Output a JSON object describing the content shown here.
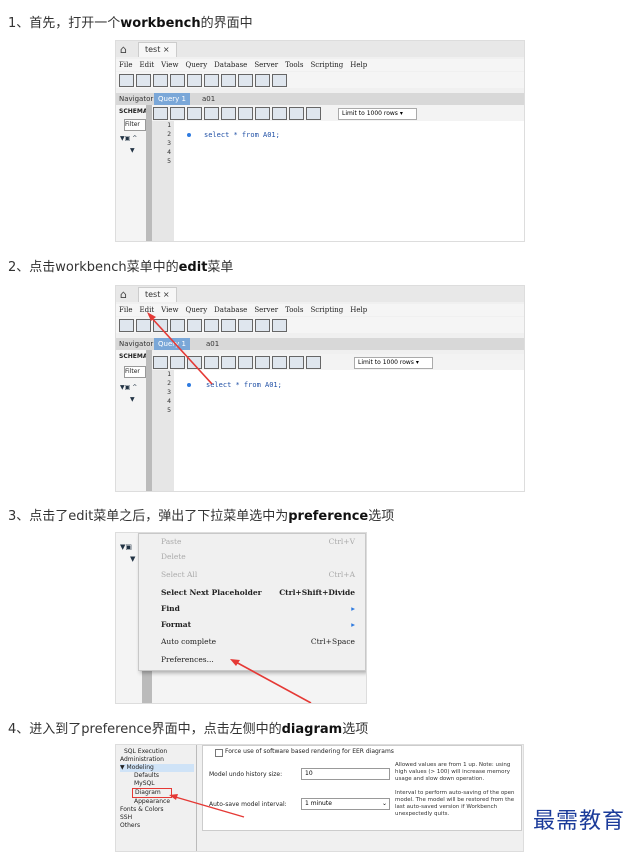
{
  "steps": [
    {
      "prefix": "1、首先，打开一个",
      "bold": "workbench",
      "suffix": "的界面中"
    },
    {
      "prefix": "2、点击workbench菜单中的",
      "bold": "edit",
      "suffix": "菜单"
    },
    {
      "prefix": "3、点击了edit菜单之后，弹出了下拉菜单选中为",
      "bold": "preference",
      "suffix": "选项"
    },
    {
      "prefix": "4、进入到了preference界面中，点击左侧中的",
      "bold": "diagram",
      "suffix": "选项"
    }
  ],
  "workbench": {
    "tab_label": "test",
    "menus": [
      "File",
      "Edit",
      "View",
      "Query",
      "Database",
      "Server",
      "Tools",
      "Scripting",
      "Help"
    ],
    "navigator_label": "Navigator",
    "query_tab": "Query 1",
    "sub_tab": "a01",
    "schemas_label": "SCHEMAS",
    "filter_placeholder": "Filter",
    "limit_label": "Limit to 1000 rows",
    "line_numbers": [
      "1",
      "2",
      "3",
      "4",
      "5"
    ],
    "code_line": "select * from A01;"
  },
  "edit_menu": {
    "items": [
      {
        "label": "Paste",
        "shortcut": "Ctrl+V",
        "disabled": true
      },
      {
        "label": "Delete",
        "shortcut": "",
        "disabled": true
      },
      {
        "label": "Select All",
        "shortcut": "Ctrl+A",
        "disabled": true
      },
      {
        "label": "Select Next Placeholder",
        "shortcut": "Ctrl+Shift+Divide",
        "disabled": false
      },
      {
        "label": "Find",
        "shortcut": "▸",
        "disabled": false
      },
      {
        "label": "Format",
        "shortcut": "▸",
        "disabled": false
      },
      {
        "label": "Auto complete",
        "shortcut": "Ctrl+Space",
        "disabled": false
      },
      {
        "label": "Preferences...",
        "shortcut": "",
        "disabled": false
      }
    ]
  },
  "preferences": {
    "tree": [
      "SQL Execution",
      "Administration",
      "▼ Modeling",
      "Defaults",
      "MySQL",
      "Diagram",
      "Appearance",
      "Fonts & Colors",
      "SSH",
      "Others"
    ],
    "checkbox_label": "Force use of software based rendering for EER diagrams",
    "undo_label": "Model undo history size:",
    "undo_value": "10",
    "undo_note": "Allowed values are from 1 up. Note: using high values (> 100) will increase memory usage and slow down operation.",
    "autosave_label": "Auto-save model interval:",
    "autosave_value": "1 minute",
    "autosave_note": "Interval to perform auto-saving of the open model. The model will be restored from the last auto-saved version if Workbench unexpectedly quits."
  },
  "watermark": "最需教育",
  "colors": {
    "arrow": "#e53935",
    "accent": "#2f7be0",
    "watermark": "#1b3b9a"
  }
}
